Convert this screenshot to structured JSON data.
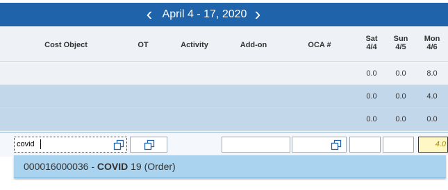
{
  "period": {
    "label": "April 4 - 17, 2020",
    "prev_icon": "chevron-left-icon",
    "next_icon": "chevron-right-icon"
  },
  "columns": {
    "cost_object": "Cost Object",
    "ot": "OT",
    "activity": "Activity",
    "addon": "Add-on",
    "oca": "OCA #",
    "days": [
      {
        "day": "Sat",
        "date": "4/4"
      },
      {
        "day": "Sun",
        "date": "4/5"
      },
      {
        "day": "Mon",
        "date": "4/6"
      }
    ]
  },
  "rows": [
    {
      "sat": "0.0",
      "sun": "0.0",
      "mon": "8.0"
    },
    {
      "sat": "0.0",
      "sun": "0.0",
      "mon": "4.0"
    },
    {
      "sat": "0.0",
      "sun": "0.0",
      "mon": "0.0"
    }
  ],
  "edit_row": {
    "cost_object_value": "covid",
    "mon_value": "4.0",
    "value_help_icon": "value-help-icon"
  },
  "suggestion": {
    "prefix": "000016000036 - ",
    "match": "COVID",
    "suffix": " 19 (Order)"
  },
  "colors": {
    "titlebar": "#1f63ab",
    "row_highlight": "#c3d7eb",
    "suggestion_bg": "#a9d3ef",
    "input_highlight": "#fff8c4"
  }
}
